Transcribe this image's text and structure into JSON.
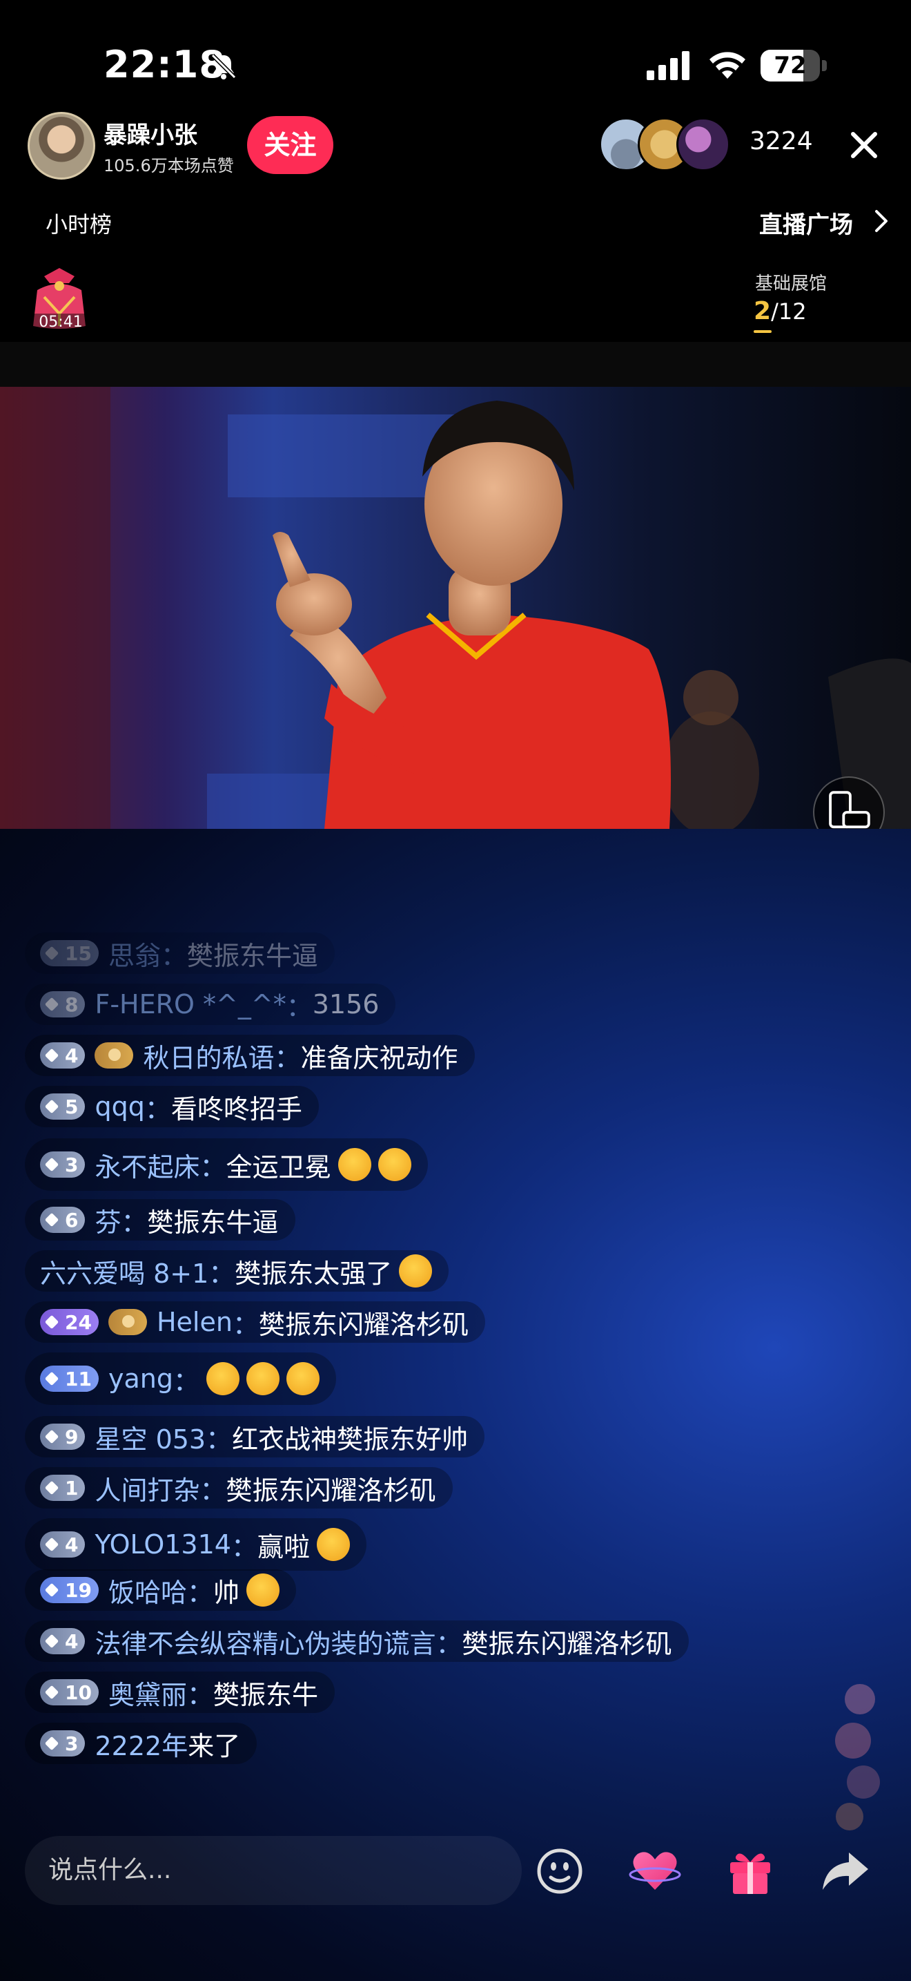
{
  "status_bar": {
    "time": "22:18",
    "battery": "72",
    "battery_level": 0.72
  },
  "host": {
    "name": "暴躁小张",
    "likes": "105.6万本场点赞",
    "follow_label": "关注"
  },
  "viewers": {
    "count": "3224"
  },
  "rank": {
    "label": "小时榜"
  },
  "plaza": {
    "label": "直播广场"
  },
  "gift_bag": {
    "timer": "05:41"
  },
  "exhibit": {
    "label": "基础展馆",
    "current": "2",
    "total": "/12"
  },
  "chat": [
    {
      "level": "15",
      "badge": "default",
      "fan": false,
      "user": "思翁",
      "sep": "：",
      "text": "樊振东牛逼",
      "emoji": 0
    },
    {
      "level": "8",
      "badge": "default",
      "fan": false,
      "user": "F-HERO  *^_^*",
      "sep": "：",
      "text": "3156",
      "emoji": 0
    },
    {
      "level": "4",
      "badge": "default",
      "fan": true,
      "user": "秋日的私语",
      "sep": "：",
      "text": "准备庆祝动作",
      "emoji": 0
    },
    {
      "level": "5",
      "badge": "default",
      "fan": false,
      "user": "qqq",
      "sep": "：",
      "text": "看咚咚招手",
      "emoji": 0
    },
    {
      "level": "3",
      "badge": "default",
      "fan": false,
      "user": "永不起床",
      "sep": "：",
      "text": "全运卫冕",
      "emoji": 2
    },
    {
      "level": "6",
      "badge": "default",
      "fan": false,
      "user": "芬",
      "sep": "：",
      "text": "樊振东牛逼",
      "emoji": 0
    },
    {
      "level": "",
      "badge": "none",
      "fan": false,
      "user": "六六爱喝 8+1",
      "sep": "：",
      "text": "樊振东太强了",
      "emoji": 1
    },
    {
      "level": "24",
      "badge": "purple",
      "fan": true,
      "user": "Helen",
      "sep": "：",
      "text": "樊振东闪耀洛杉矶",
      "emoji": 0
    },
    {
      "level": "11",
      "badge": "blue",
      "fan": false,
      "user": "yang",
      "sep": "：",
      "text": "",
      "emoji": 3
    },
    {
      "level": "9",
      "badge": "default",
      "fan": false,
      "user": "星空 053",
      "sep": "：",
      "text": "红衣战神樊振东好帅",
      "emoji": 0
    },
    {
      "level": "1",
      "badge": "default",
      "fan": false,
      "user": "人间打杂",
      "sep": "：",
      "text": "樊振东闪耀洛杉矶",
      "emoji": 0
    },
    {
      "level": "4",
      "badge": "default",
      "fan": false,
      "user": "YOLO1314",
      "sep": "：",
      "text": "赢啦",
      "emoji": 1
    },
    {
      "level": "19",
      "badge": "blue",
      "fan": false,
      "user": "饭哈哈",
      "sep": "：",
      "text": "帅",
      "emoji": 1
    },
    {
      "level": "4",
      "badge": "default",
      "fan": false,
      "user": "法律不会纵容精心伪装的谎言",
      "sep": "：",
      "text": "樊振东闪耀洛杉矶",
      "emoji": 0
    },
    {
      "level": "10",
      "badge": "default",
      "fan": false,
      "user": "奥黛丽",
      "sep": "：",
      "text": "樊振东牛",
      "emoji": 0
    },
    {
      "level": "3",
      "badge": "default",
      "fan": false,
      "user": "2222年",
      "sep": " ",
      "text": "来了",
      "emoji": 0
    }
  ],
  "input": {
    "placeholder": "说点什么..."
  },
  "icons": {
    "bell": "bell-slash-icon",
    "signal": "cellular-signal-icon",
    "wifi": "wifi-icon",
    "close": "close-icon",
    "chevron": "chevron-right-icon",
    "rotate": "rotate-screen-icon",
    "emoji": "emoji-icon",
    "heart": "heart-icon",
    "gift": "gift-icon",
    "share": "share-icon"
  },
  "colors": {
    "follow": "#fe2c55",
    "username": "#9bc2ff",
    "accent_gold": "#f5c542"
  }
}
